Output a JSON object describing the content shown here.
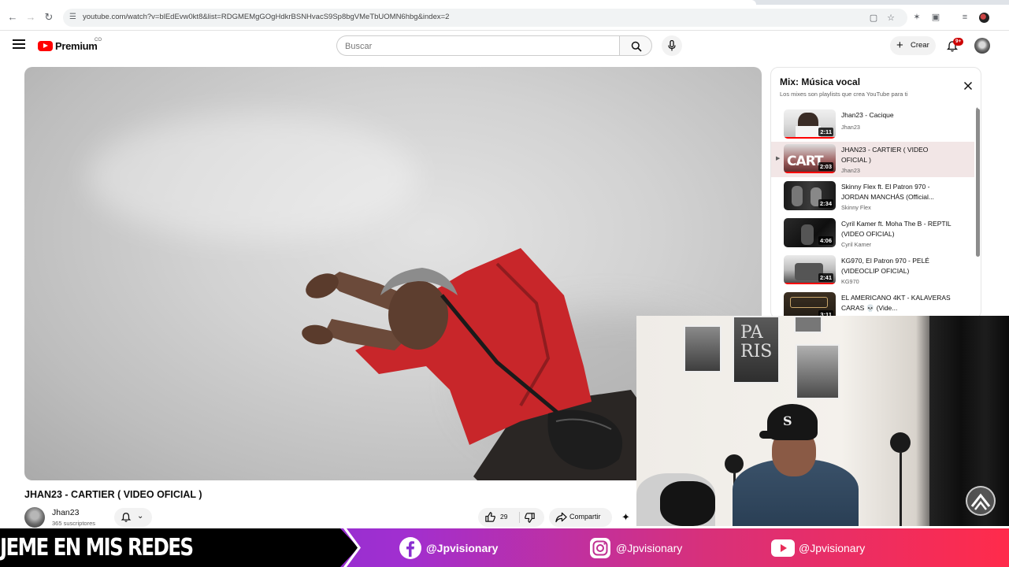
{
  "browser": {
    "url": "youtube.com/watch?v=blEdEvw0kt8&list=RDGMEMgGOgHdkrBSNHvacS9Sp8bgVMeTbUOMN6hbg&index=2"
  },
  "header": {
    "brand": "Premium",
    "region": "CO",
    "search_placeholder": "Buscar",
    "create_label": "Crear",
    "notification_count": "9+"
  },
  "video": {
    "title": "JHAN23 - CARTIER ( VIDEO OFICIAL )",
    "channel": "Jhan23",
    "subscribers": "365 suscriptores",
    "likes": "29",
    "share_label": "Compartir"
  },
  "playlist": {
    "title": "Mix: Música vocal",
    "subtitle": "Los mixes son playlists que crea YouTube para ti",
    "items": [
      {
        "title": "Jhan23 - Cacique",
        "channel": "Jhan23",
        "duration": "2:11",
        "active": false
      },
      {
        "title": "JHAN23 - CARTIER ( VIDEO OFICIAL )",
        "channel": "Jhan23",
        "duration": "2:03",
        "active": true
      },
      {
        "title": "Skinny Flex ft. El Patron 970 - JORDAN MANCHÁS (Official...",
        "channel": "Skinny Flex",
        "duration": "2:34",
        "active": false
      },
      {
        "title": "Cyril Kamer ft. Moha The B - REPTIL (VIDEO OFICIAL)",
        "channel": "Cyril Kamer",
        "duration": "4:06",
        "active": false
      },
      {
        "title": "KG970, El Patron 970 - PELÉ (VIDEOCLIP OFICIAL)",
        "channel": "KG970",
        "duration": "2:41",
        "active": false
      },
      {
        "title": "EL AMERICANO 4KT - KALAVERAS CARAS 💀 (Vide...",
        "channel": "",
        "duration": "3:11",
        "active": false
      }
    ]
  },
  "banner": {
    "text": "JEME EN MIS REDES",
    "facebook": "@Jpvisionary",
    "instagram": "@Jpvisionary",
    "youtube": "@Jpvisionary"
  },
  "colors": {
    "yt_red": "#ff0000",
    "banner_start": "#6b2fd1",
    "banner_end": "#ff2b4b"
  }
}
